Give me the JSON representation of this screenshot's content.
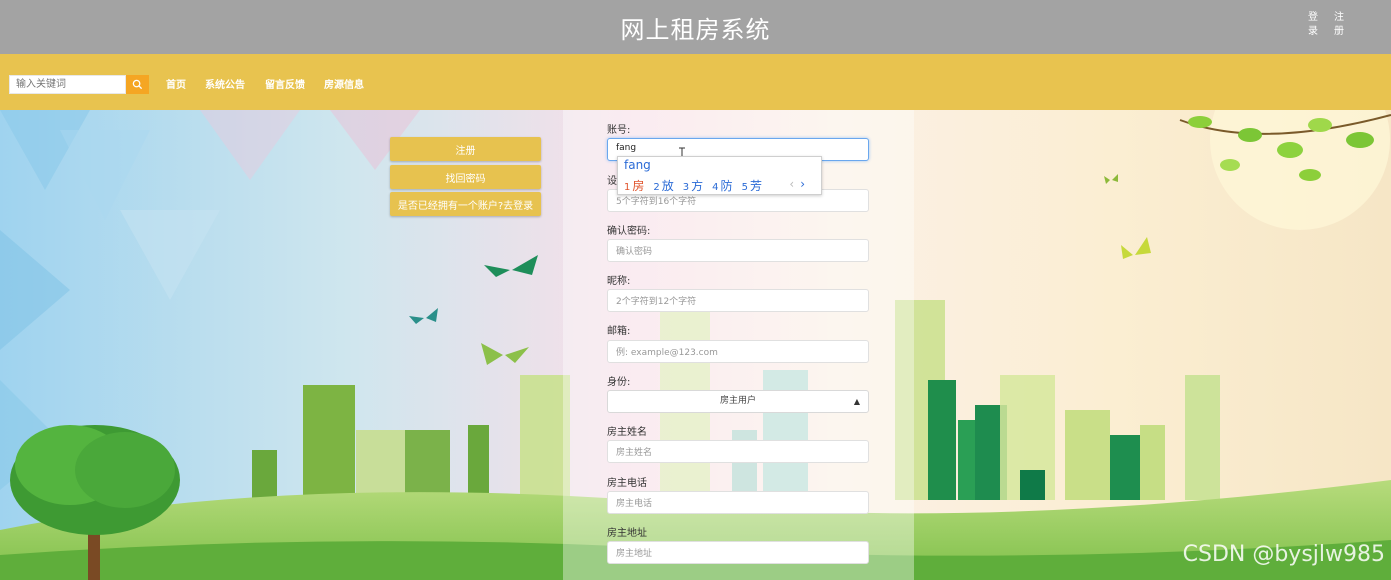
{
  "header": {
    "title": "网上租房系统",
    "auth_links": [
      "登录",
      "注册"
    ]
  },
  "nav": {
    "search_placeholder": "输入关键词",
    "items": [
      "首页",
      "系统公告",
      "留言反馈",
      "房源信息"
    ]
  },
  "side_buttons": [
    "注册",
    "找回密码",
    "是否已经拥有一个账户?去登录"
  ],
  "form": {
    "account_label": "账号:",
    "account_value": "fang",
    "password_label": "设",
    "password_placeholder": "5个字符到16个字符",
    "confirm_label": "确认密码:",
    "confirm_placeholder": "确认密码",
    "nickname_label": "昵称:",
    "nickname_placeholder": "2个字符到12个字符",
    "email_label": "邮箱:",
    "email_placeholder": "例: example@123.com",
    "identity_label": "身份:",
    "identity_value": "房主用户",
    "owner_name_label": "房主姓名",
    "owner_name_placeholder": "房主姓名",
    "owner_phone_label": "房主电话",
    "owner_phone_placeholder": "房主电话",
    "owner_address_label": "房主地址",
    "owner_address_placeholder": "房主地址"
  },
  "ime": {
    "composition": "fang",
    "candidates": [
      {
        "num": "1",
        "text": "房"
      },
      {
        "num": "2",
        "text": "放"
      },
      {
        "num": "3",
        "text": "方"
      },
      {
        "num": "4",
        "text": "防"
      },
      {
        "num": "5",
        "text": "芳"
      }
    ]
  },
  "watermark": "CSDN @bysjlw985",
  "colors": {
    "header_bg": "#a3a3a3",
    "nav_bg": "#e8c34f",
    "button_bg": "#e7c24f",
    "search_btn": "#f5a623"
  }
}
